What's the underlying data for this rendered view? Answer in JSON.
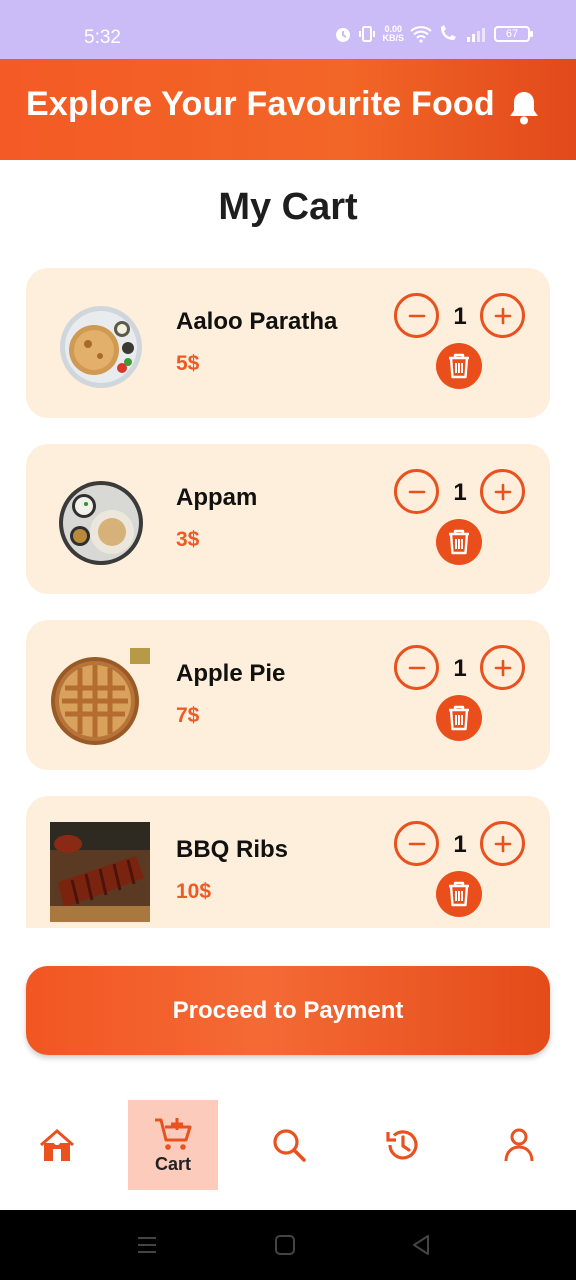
{
  "status_bar": {
    "time": "5:32",
    "net_speed_value": "0.00",
    "net_speed_unit": "KB/S",
    "battery": "67"
  },
  "header": {
    "title": "Explore Your Favourite Food",
    "bell_icon": "bell-icon"
  },
  "page": {
    "title": "My Cart"
  },
  "cart_items": [
    {
      "name": "Aaloo Paratha",
      "price": "5$",
      "quantity": "1",
      "image": "aaloo-paratha-image"
    },
    {
      "name": "Appam",
      "price": "3$",
      "quantity": "1",
      "image": "appam-image"
    },
    {
      "name": "Apple Pie",
      "price": "7$",
      "quantity": "1",
      "image": "apple-pie-image"
    },
    {
      "name": "BBQ Ribs",
      "price": "10$",
      "quantity": "1",
      "image": "bbq-ribs-image"
    }
  ],
  "payment_button": {
    "label": "Proceed to Payment"
  },
  "bottom_nav": {
    "items": [
      {
        "icon": "home-icon",
        "label": ""
      },
      {
        "icon": "cart-icon",
        "label": "Cart",
        "active": true
      },
      {
        "icon": "search-icon",
        "label": ""
      },
      {
        "icon": "history-icon",
        "label": ""
      },
      {
        "icon": "profile-icon",
        "label": ""
      }
    ]
  },
  "colors": {
    "accent": "#ee5a24",
    "header_start": "#f45a26",
    "header_end": "#e2491b",
    "card_background": "#fdefdb",
    "status_bar": "#cbbcf8",
    "active_nav_background": "#fccbbb"
  }
}
